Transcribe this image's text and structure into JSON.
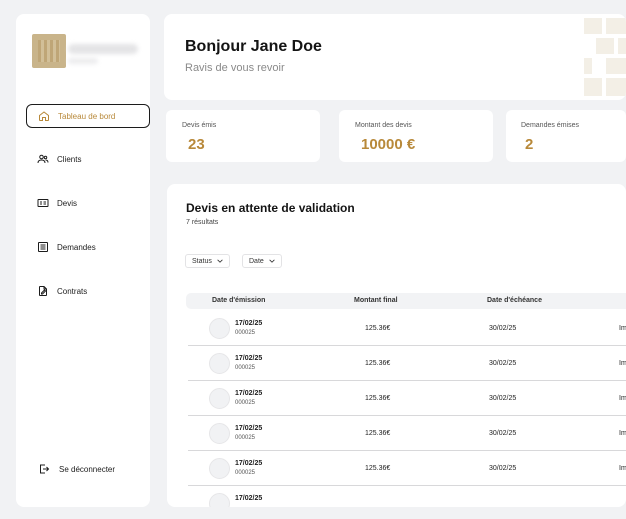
{
  "sidebar": {
    "items": [
      {
        "label": "Tableau de bord",
        "icon": "home-icon"
      },
      {
        "label": "Clients",
        "icon": "users-icon"
      },
      {
        "label": "Devis",
        "icon": "invoice-icon"
      },
      {
        "label": "Demandes",
        "icon": "list-icon"
      },
      {
        "label": "Contrats",
        "icon": "contract-icon"
      }
    ],
    "logout_label": "Se déconnecter"
  },
  "header": {
    "greeting": "Bonjour Jane Doe",
    "subtitle": "Ravis de vous revoir"
  },
  "stats": [
    {
      "label": "Devis émis",
      "value": "23"
    },
    {
      "label": "Montant des devis",
      "value": "10000 €"
    },
    {
      "label": "Demandes émises",
      "value": "2"
    }
  ],
  "pending": {
    "title": "Devis en attente de validation",
    "count": "7 résultats",
    "filters": {
      "status": "Status",
      "date": "Date"
    },
    "columns": [
      "Date d'émission",
      "Montant final",
      "Date d'échéance"
    ],
    "rows": [
      {
        "date": "17/02/25",
        "ref": "000025",
        "amount": "125.36€",
        "due": "30/02/25",
        "extra": "Im"
      },
      {
        "date": "17/02/25",
        "ref": "000025",
        "amount": "125.36€",
        "due": "30/02/25",
        "extra": "Im"
      },
      {
        "date": "17/02/25",
        "ref": "000025",
        "amount": "125.36€",
        "due": "30/02/25",
        "extra": "Im"
      },
      {
        "date": "17/02/25",
        "ref": "000025",
        "amount": "125.36€",
        "due": "30/02/25",
        "extra": "Im"
      },
      {
        "date": "17/02/25",
        "ref": "000025",
        "amount": "125.36€",
        "due": "30/02/25",
        "extra": "Im"
      },
      {
        "date": "17/02/25",
        "ref": "",
        "amount": "",
        "due": "",
        "extra": ""
      }
    ]
  },
  "colors": {
    "accent": "#b8893a",
    "background": "#f1f2f4",
    "card": "#ffffff"
  }
}
